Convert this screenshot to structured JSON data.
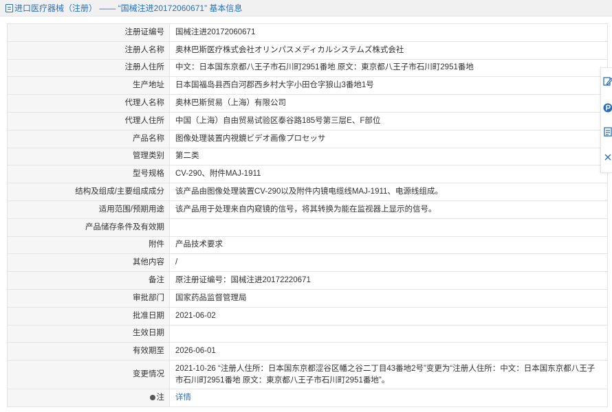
{
  "header": {
    "title": "进口医疗器械（注册） —— “国械注进20172060671” 基本信息"
  },
  "rows": [
    {
      "label": "注册证编号",
      "value": "国械注进20172060671"
    },
    {
      "label": "注册人名称",
      "value": "奥林巴斯医疗株式会社オリンパスメディカルシステムズ株式会社"
    },
    {
      "label": "注册人住所",
      "value": "中文：日本国东京都八王子市石川町2951番地 原文：東京都八王子市石川町2951番地"
    },
    {
      "label": "生产地址",
      "value": "日本国福岛县西白河郡西乡村大字小田仓字狼山3番地1号"
    },
    {
      "label": "代理人名称",
      "value": "奥林巴斯贸易（上海）有限公司"
    },
    {
      "label": "代理人住所",
      "value": "中国（上海）自由贸易试验区泰谷路185号第三层E、F部位"
    },
    {
      "label": "产品名称",
      "value": "图像处理装置内視鏡ビデオ画像プロセッサ"
    },
    {
      "label": "管理类别",
      "value": "第二类"
    },
    {
      "label": "型号规格",
      "value": "CV-290、附件MAJ-1911"
    },
    {
      "label": "结构及组成/主要组成成分",
      "value": "该产品由图像处理装置CV-290以及附件内镜电缆线MAJ-1911、电源线组成。"
    },
    {
      "label": "适用范围/预期用途",
      "value": "该产品用于处理来自内窥镜的信号，将其转换为能在监视器上显示的信号。"
    },
    {
      "label": "产品储存条件及有效期",
      "value": ""
    },
    {
      "label": "附件",
      "value": "产品技术要求"
    },
    {
      "label": "其他内容",
      "value": "/"
    },
    {
      "label": "备注",
      "value": "原注册证编号：国械注进20172220671"
    },
    {
      "label": "审批部门",
      "value": "国家药品监督管理局"
    },
    {
      "label": "批准日期",
      "value": "2021-06-02"
    },
    {
      "label": "生效日期",
      "value": ""
    },
    {
      "label": "有效期至",
      "value": "2026-06-01"
    },
    {
      "label": "变更情况",
      "value": "2021-10-26 “注册人住所：日本国东京都涩谷区幡之谷二丁目43番地2号”变更为“注册人住所：中文：日本国东京都八王子市石川町2951番地 原文：東京都八王子市石川町2951番地”。"
    }
  ],
  "note": {
    "label": "注",
    "link_text": "详情"
  },
  "sidebar": {
    "icons": [
      "edit-icon",
      "p-icon",
      "list-icon",
      "close-icon"
    ]
  },
  "colors": {
    "accent": "#2a6ebb",
    "label_bg": "#f6f6f6",
    "border": "#e4e4e4"
  }
}
